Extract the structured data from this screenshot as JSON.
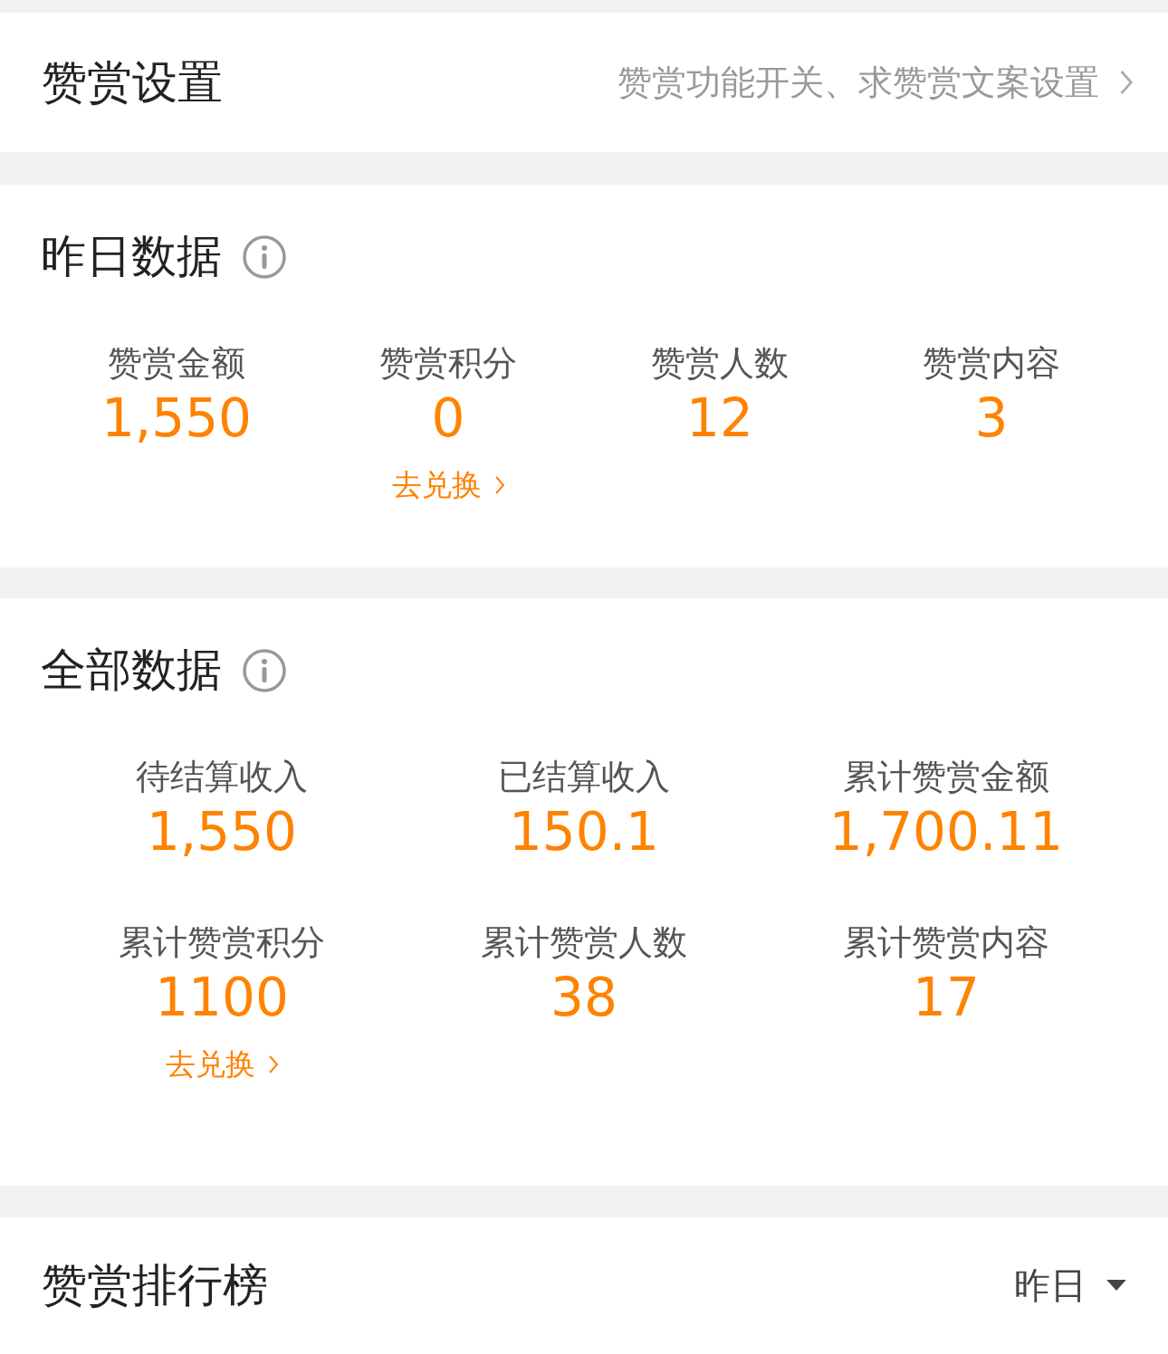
{
  "settings": {
    "title": "赞赏设置",
    "description": "赞赏功能开关、求赞赏文案设置"
  },
  "yesterday": {
    "title": "昨日数据",
    "stats": [
      {
        "label": "赞赏金额",
        "value": "1,550"
      },
      {
        "label": "赞赏积分",
        "value": "0",
        "link": "去兑换"
      },
      {
        "label": "赞赏人数",
        "value": "12"
      },
      {
        "label": "赞赏内容",
        "value": "3"
      }
    ]
  },
  "all": {
    "title": "全部数据",
    "stats": [
      {
        "label": "待结算收入",
        "value": "1,550"
      },
      {
        "label": "已结算收入",
        "value": "150.1"
      },
      {
        "label": "累计赞赏金额",
        "value": "1,700.11"
      },
      {
        "label": "累计赞赏积分",
        "value": "1100",
        "link": "去兑换"
      },
      {
        "label": "累计赞赏人数",
        "value": "38"
      },
      {
        "label": "累计赞赏内容",
        "value": "17"
      }
    ]
  },
  "ranking": {
    "title": "赞赏排行榜",
    "period": "昨日"
  }
}
